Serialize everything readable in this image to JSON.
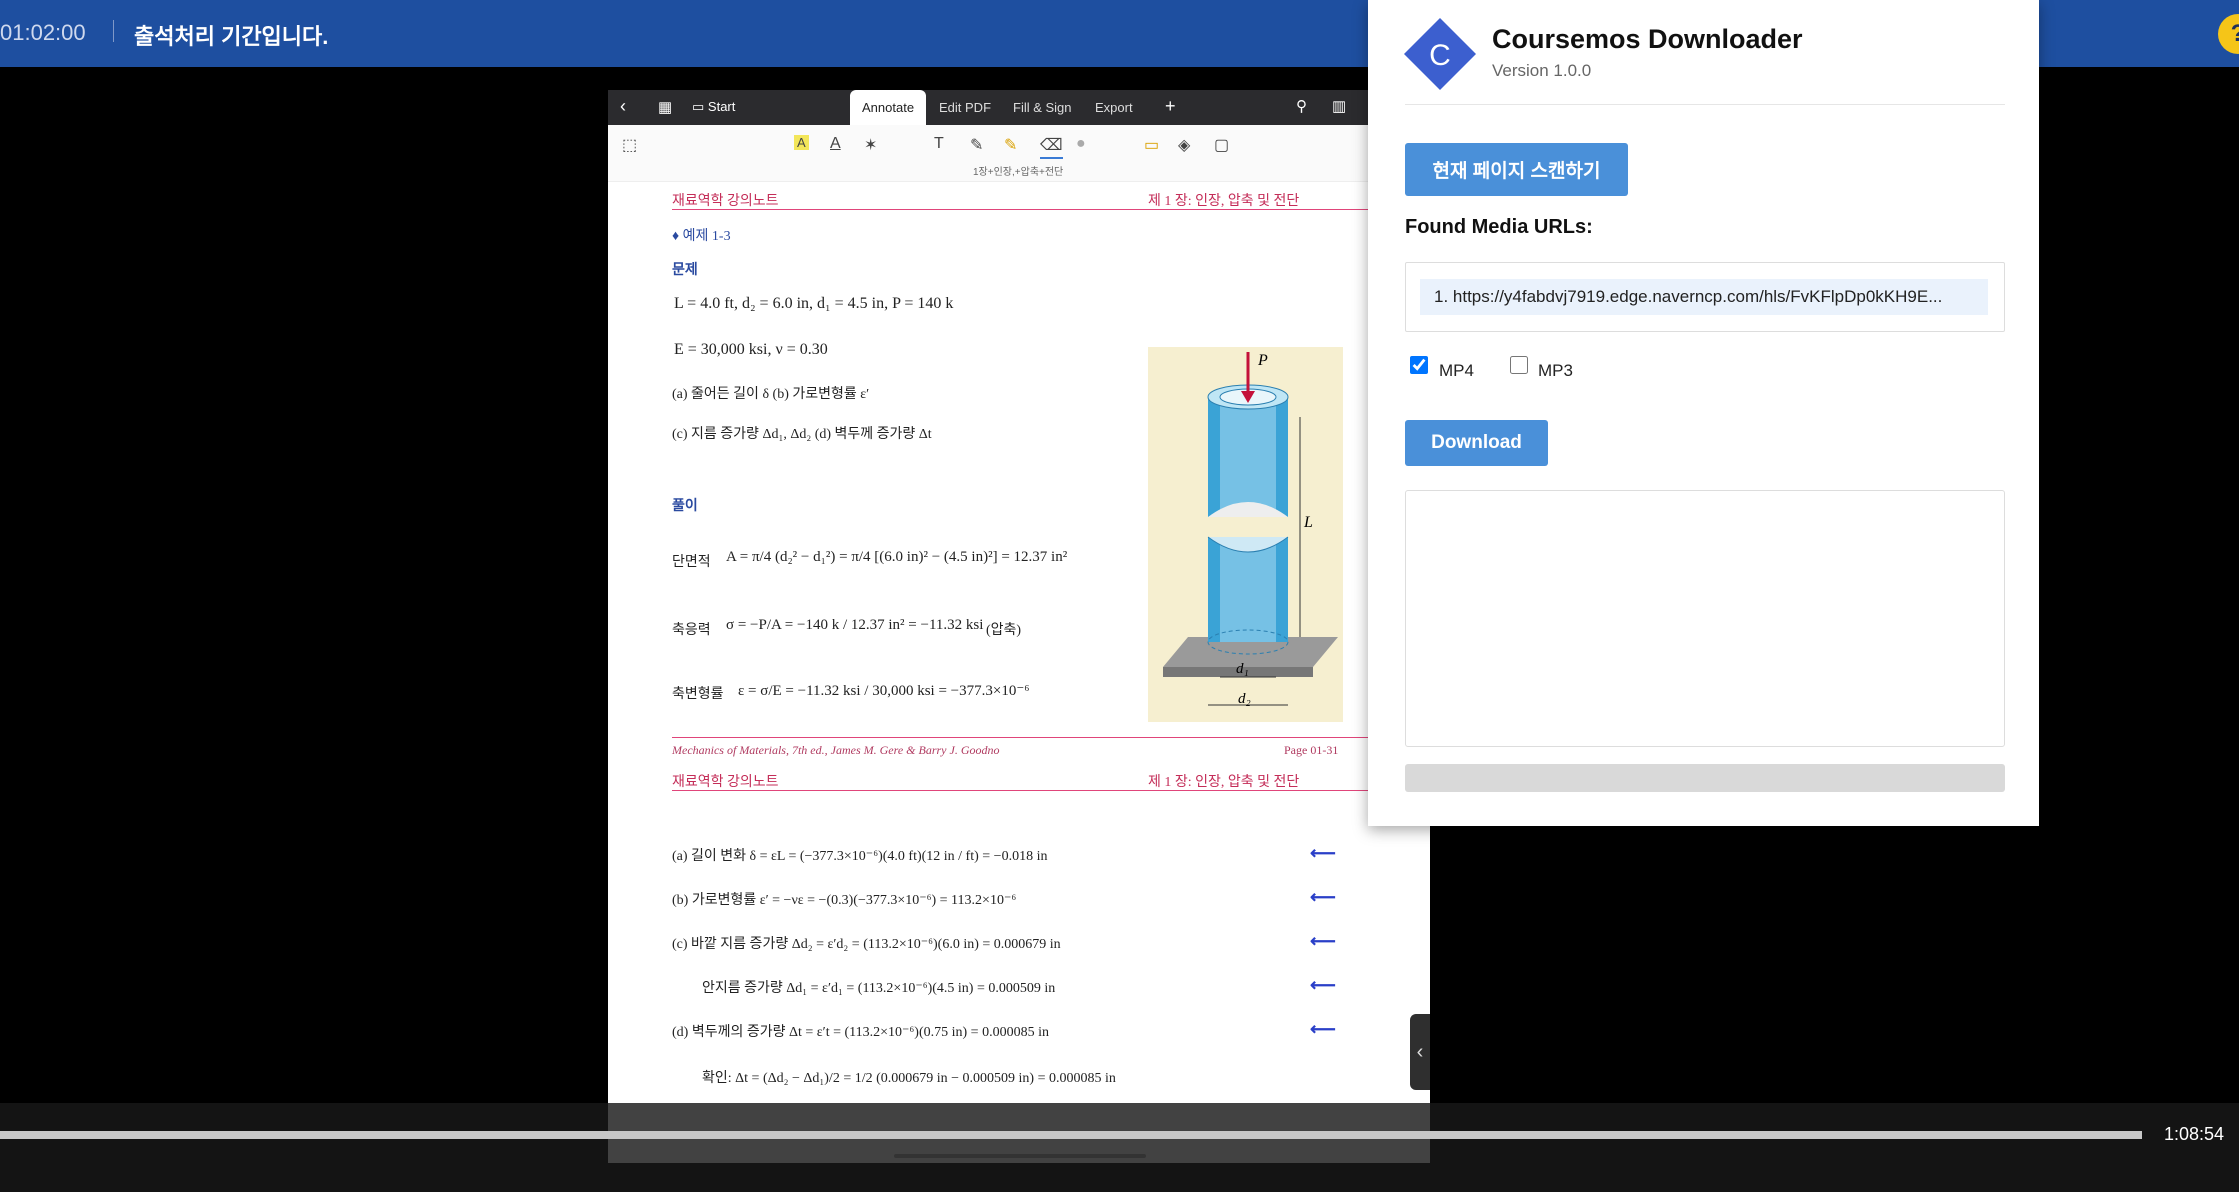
{
  "video_header": {
    "time": "01:02:00",
    "title": "출석처리 기간입니다."
  },
  "pdf_toolbar": {
    "back_icon": "chevron-left-icon",
    "grid_icon": "grid-icon",
    "start_label": "Start",
    "tabs": [
      "Annotate",
      "Edit PDF",
      "Fill & Sign",
      "Export"
    ],
    "active_tab": "Annotate",
    "add_icon": "plus-icon",
    "search_icon": "search-icon",
    "book_icon": "book-icon"
  },
  "annotate_tools": {
    "caption": "1장+인장,+압축+전단"
  },
  "pdf_content": {
    "header_left": "재료역학 강의노트",
    "header_right": "제 1 장:  인장, 압축 및 전단",
    "example_title": "♦  예제 1-3",
    "problem_label": "문제",
    "given_1": "L = 4.0 ft, d₂ = 6.0 in, d₁ = 4.5 in, P = 140 k",
    "given_2": "E = 30,000 ksi,  ν = 0.30",
    "q_a": "(a) 줄어든 길이  δ  (b) 가로변형률  ε′",
    "q_c": "(c) 지름 증가량  Δd₁, Δd₂  (d) 벽두께 증가량  Δt",
    "solution_label": "풀이",
    "area_label": "단면적",
    "area_eq": "A = π/4 (d₂² − d₁²) = π/4 [(6.0 in)² − (4.5 in)²] = 12.37 in²",
    "stress_label": "축응력",
    "stress_eq": "σ = −P/A = −140 k / 12.37 in² = −11.32 ksi",
    "stress_note": "(압축)",
    "strain_label": "축변형률",
    "strain_eq": "ε = σ/E = −11.32 ksi / 30,000 ksi = −377.3×10⁻⁶",
    "footer_text": "Mechanics of Materials, 7th ed., James M. Gere & Barry J. Goodno",
    "footer_page": "Page 01-31",
    "figure_labels": {
      "p": "P",
      "l": "L",
      "d1": "d₁",
      "d2": "d₂"
    },
    "sol_a": "(a) 길이 변화  δ = εL = (−377.3×10⁻⁶)(4.0 ft)(12 in / ft) = −0.018 in",
    "sol_b": "(b) 가로변형률  ε′ = −νε = −(0.3)(−377.3×10⁻⁶) = 113.2×10⁻⁶",
    "sol_c1": "(c) 바깥 지름 증가량  Δd₂ = ε′d₂ = (113.2×10⁻⁶)(6.0 in) = 0.000679 in",
    "sol_c2": "안지름 증가량        Δd₁ = ε′d₁ = (113.2×10⁻⁶)(4.5 in) = 0.000509 in",
    "sol_d": "(d) 벽두께의 증가량  Δt = ε′t = (113.2×10⁻⁶)(0.75 in) = 0.000085 in",
    "check": "확인:  Δt = (Δd₂ − Δd₁)/2 = 1/2 (0.000679 in − 0.000509 in) = 0.000085 in",
    "arrow_icon": "arrow-left-icon"
  },
  "downloader": {
    "logo_icon": "c-diamond-logo-icon",
    "title": "Coursemos Downloader",
    "version": "Version 1.0.0",
    "scan_button": "현재 페이지 스캔하기",
    "found_label": "Found Media URLs:",
    "urls": [
      "1. https://y4fabdvj7919.edge.naverncp.com/hls/FvKFlpDp0kKH9E..."
    ],
    "mp4_label": "MP4",
    "mp4_checked": true,
    "mp3_label": "MP3",
    "mp3_checked": false,
    "download_button": "Download",
    "log_text": "",
    "progress": 0
  },
  "player": {
    "duration": "1:08:54",
    "progress_fraction": 1.0,
    "side_toggle_icon": "chevron-left-icon",
    "help_icon": "help-icon",
    "help_label": "?"
  },
  "colors": {
    "header_blue": "#1e4fa0",
    "accent_blue": "#4a90d9",
    "pdf_header_pink": "#c42d58",
    "help_yellow": "#f5c518"
  }
}
